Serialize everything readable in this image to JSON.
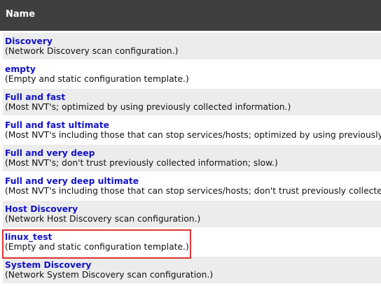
{
  "table": {
    "header": {
      "name": "Name"
    },
    "rows": [
      {
        "name": "Discovery",
        "comment": "(Network Discovery scan configuration.)"
      },
      {
        "name": "empty",
        "comment": "(Empty and static configuration template.)"
      },
      {
        "name": "Full and fast",
        "comment": "(Most NVT's; optimized by using previously collected information.)"
      },
      {
        "name": "Full and fast ultimate",
        "comment": "(Most NVT's including those that can stop services/hosts; optimized by using previously c"
      },
      {
        "name": "Full and very deep",
        "comment": "(Most NVT's; don't trust previously collected information; slow.)"
      },
      {
        "name": "Full and very deep ultimate",
        "comment": "(Most NVT's including those that can stop services/hosts; don't trust previously collected"
      },
      {
        "name": "Host Discovery",
        "comment": "(Network Host Discovery scan configuration.)"
      },
      {
        "name": "linux_test",
        "comment": "(Empty and static configuration template.)"
      },
      {
        "name": "System Discovery",
        "comment": "(Network System Discovery scan configuration.)"
      }
    ],
    "highlighted_row": "linux_test"
  },
  "colors": {
    "header_bg": "#3f3f3f",
    "header_text": "#ffffff",
    "row_odd": "#ececec",
    "row_even": "#ffffff",
    "link": "#1212c8",
    "highlight_border": "#e03434"
  }
}
